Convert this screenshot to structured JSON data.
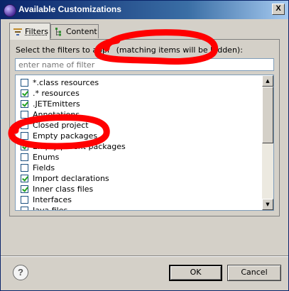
{
  "window": {
    "title": "Available Customizations",
    "close": "X"
  },
  "tabs": [
    {
      "label": "Filters",
      "icon": "filter-icon",
      "selected": true
    },
    {
      "label": "Content",
      "icon": "content-tree-icon",
      "selected": false
    }
  ],
  "filters": {
    "instruction_prefix": "Select the filters to appl",
    "instruction_suffix": "(matching items will be hidden):",
    "search_placeholder": "enter name of filter",
    "items": [
      {
        "label": "*.class resources",
        "checked": false
      },
      {
        "label": ".* resources",
        "checked": true
      },
      {
        "label": ".JETEmitters",
        "checked": true
      },
      {
        "label": "Annotations",
        "checked": false
      },
      {
        "label": "Closed project",
        "checked": false
      },
      {
        "label": "Empty packages",
        "checked": false
      },
      {
        "label": "Empty parent packages",
        "checked": true
      },
      {
        "label": "Enums",
        "checked": false
      },
      {
        "label": "Fields",
        "checked": false
      },
      {
        "label": "Import declarations",
        "checked": true
      },
      {
        "label": "Inner class files",
        "checked": true
      },
      {
        "label": "Interfaces",
        "checked": false
      },
      {
        "label": "Java files",
        "checked": false
      }
    ]
  },
  "footer": {
    "help": "?",
    "ok": "OK",
    "cancel": "Cancel"
  },
  "colors": {
    "annotation_red": "#ff0000",
    "titlebar": "#0a246a",
    "checkmark": "#21a121"
  }
}
